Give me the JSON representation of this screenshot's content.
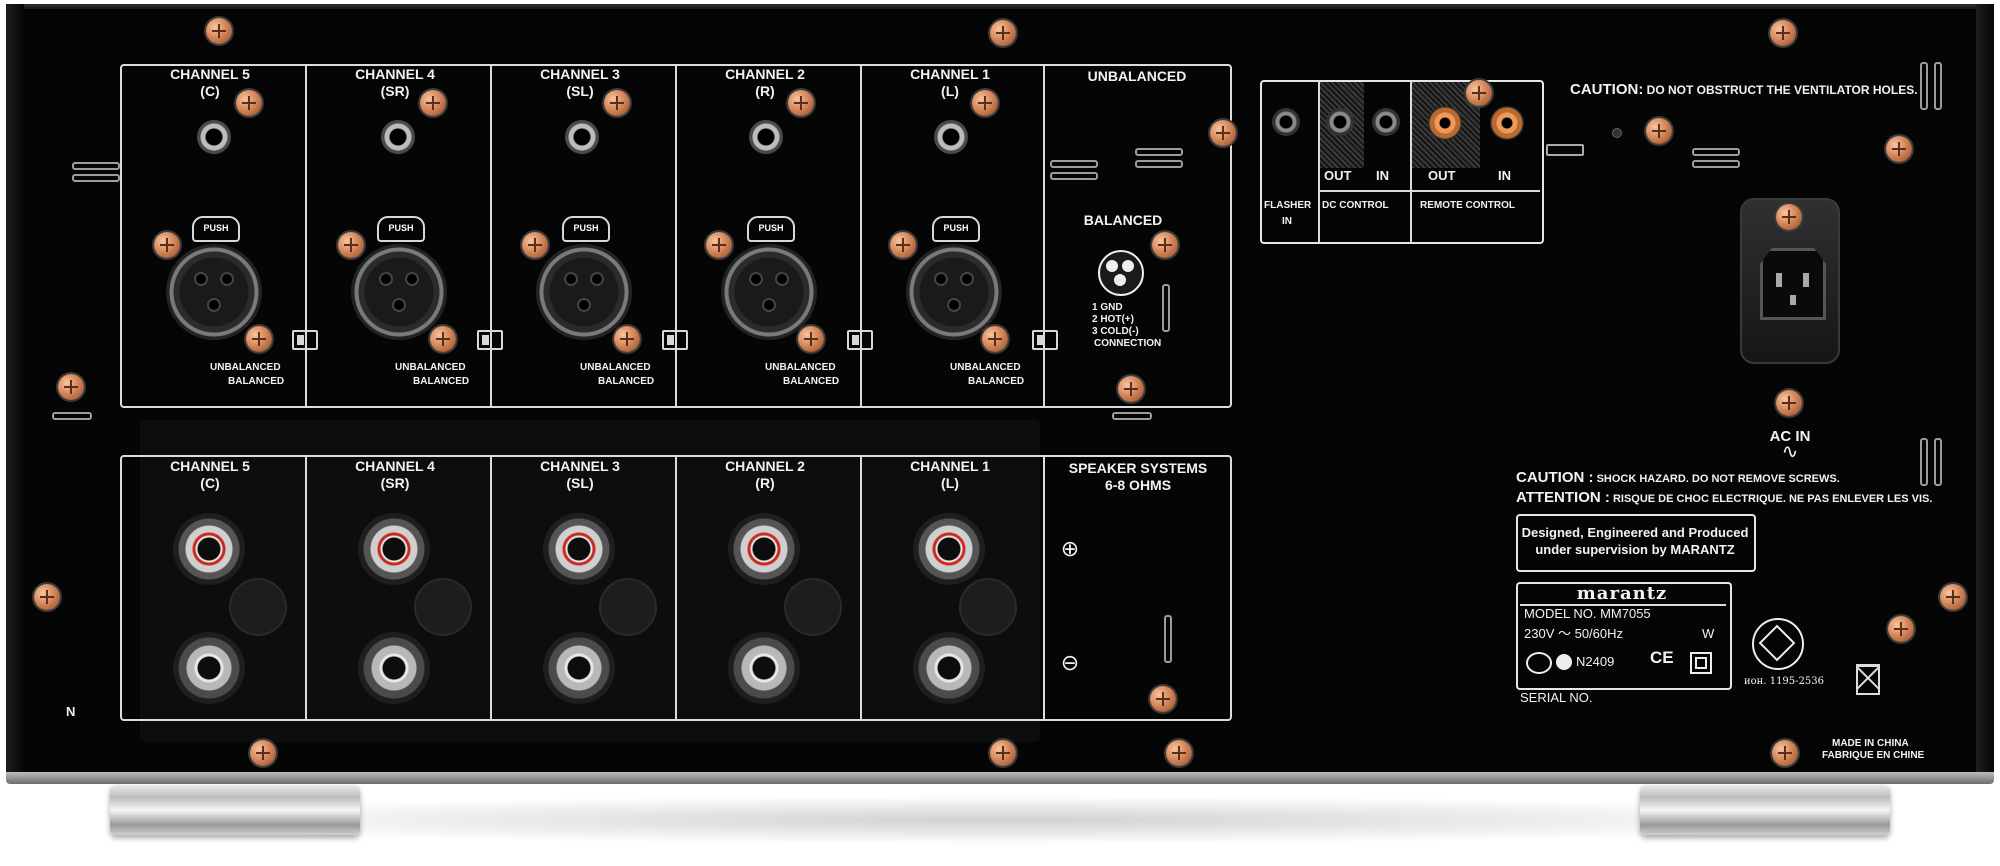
{
  "input_section": {
    "channels": [
      {
        "name": "CHANNEL 5",
        "sub": "(C)"
      },
      {
        "name": "CHANNEL 4",
        "sub": "(SR)"
      },
      {
        "name": "CHANNEL 3",
        "sub": "(SL)"
      },
      {
        "name": "CHANNEL 2",
        "sub": "(R)"
      },
      {
        "name": "CHANNEL 1",
        "sub": "(L)"
      }
    ],
    "push_label": "PUSH",
    "switch_unbalanced": "UNBALANCED",
    "switch_balanced": "BALANCED",
    "legend_unbalanced": "UNBALANCED",
    "legend_balanced": "BALANCED",
    "pinout": [
      "1 GND",
      "2 HOT(+)",
      "3 COLD(-)"
    ],
    "pinout_footer": "CONNECTION"
  },
  "control_section": {
    "flasher": "FLASHER",
    "flasher_in": "IN",
    "dc_out": "OUT",
    "dc_in": "IN",
    "dc_control": "DC CONTROL",
    "rc_out": "OUT",
    "rc_in": "IN",
    "remote_control": "REMOTE CONTROL"
  },
  "caution_top": {
    "title": "CAUTION:",
    "text": "DO NOT OBSTRUCT THE VENTILATOR HOLES."
  },
  "power": {
    "label": "AC IN",
    "symbol": "∿"
  },
  "speaker_section": {
    "channels": [
      {
        "name": "CHANNEL 5",
        "sub": "(C)"
      },
      {
        "name": "CHANNEL 4",
        "sub": "(SR)"
      },
      {
        "name": "CHANNEL 3",
        "sub": "(SL)"
      },
      {
        "name": "CHANNEL 2",
        "sub": "(R)"
      },
      {
        "name": "CHANNEL 1",
        "sub": "(L)"
      }
    ],
    "systems": "SPEAKER SYSTEMS",
    "ohms": "6-8 OHMS",
    "plus": "⊕",
    "minus": "⊖"
  },
  "warnings": {
    "caution_title": "CAUTION :",
    "caution_text": "SHOCK HAZARD. DO NOT REMOVE SCREWS.",
    "attention_title": "ATTENTION :",
    "attention_text": "RISQUE DE CHOC ELECTRIQUE. NE PAS ENLEVER LES VIS."
  },
  "designed": {
    "line1": "Designed, Engineered and Produced",
    "line2": "under supervision by MARANTZ"
  },
  "rating": {
    "brand": "marantz",
    "model": "MODEL NO. MM7055",
    "power": "230V ～ 50/60Hz",
    "watts": "W",
    "cert": "N2409",
    "ce": "CE"
  },
  "serial": "SERIAL NO.",
  "cert_number": "ион. 1195-2536",
  "made_in": {
    "en": "MADE IN CHINA",
    "fr": "FABRIQUE EN CHINE"
  },
  "side_mark": "N"
}
